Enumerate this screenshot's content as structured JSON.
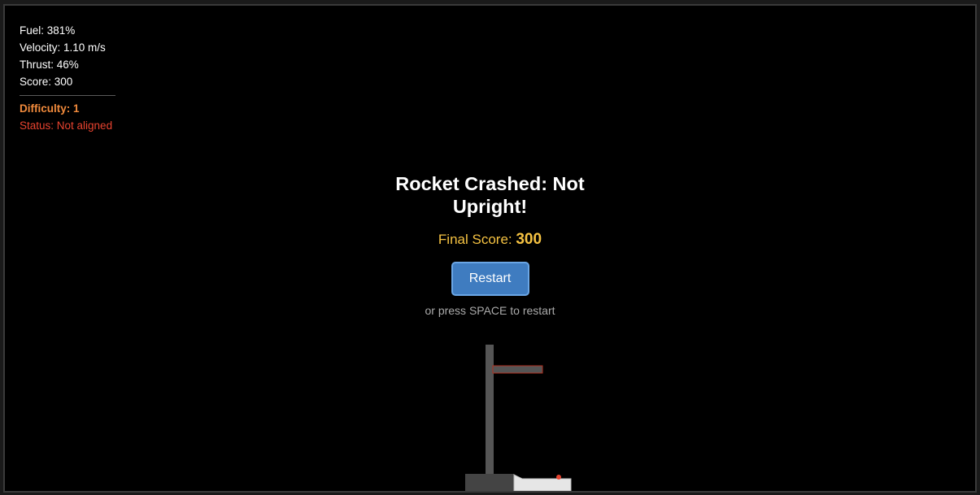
{
  "hud": {
    "fuel": "Fuel: 381%",
    "velocity": "Velocity: 1.10 m/s",
    "thrust": "Thrust: 46%",
    "score": "Score: 300",
    "difficulty": "Difficulty: 1",
    "status": "Status: Not aligned"
  },
  "game_over": {
    "title": "Rocket Crashed: Not Upright!",
    "final_score_label": "Final Score:",
    "final_score_value": "300",
    "restart_label": "Restart",
    "restart_hint": "or press SPACE to restart"
  },
  "colors": {
    "background": "#000000",
    "tower": "#555555",
    "status_text": "#e8432f",
    "difficulty_text": "#f08a3c",
    "score_text": "#f5c242",
    "button": "#3f7cc0",
    "landing_marker": "#e8432f"
  }
}
